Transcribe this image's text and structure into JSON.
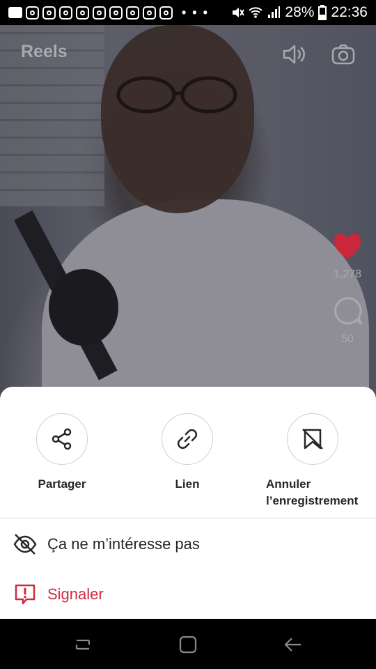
{
  "status_bar": {
    "dots": "• • •",
    "battery": "28%",
    "time": "22:36"
  },
  "reels": {
    "title": "Reels",
    "likes": "1,278",
    "comments": "50"
  },
  "sheet": {
    "actions": [
      {
        "label": "Partager",
        "icon": "share-icon"
      },
      {
        "label": "Lien",
        "icon": "link-icon"
      },
      {
        "label_line1": "Annuler",
        "label_line2": "l’enregistrement",
        "icon": "unsave-bookmark-icon"
      }
    ],
    "not_interested": "Ça ne m’intéresse pas",
    "report": "Signaler"
  },
  "colors": {
    "heart": "#c9273b",
    "report": "#d02a3f"
  }
}
